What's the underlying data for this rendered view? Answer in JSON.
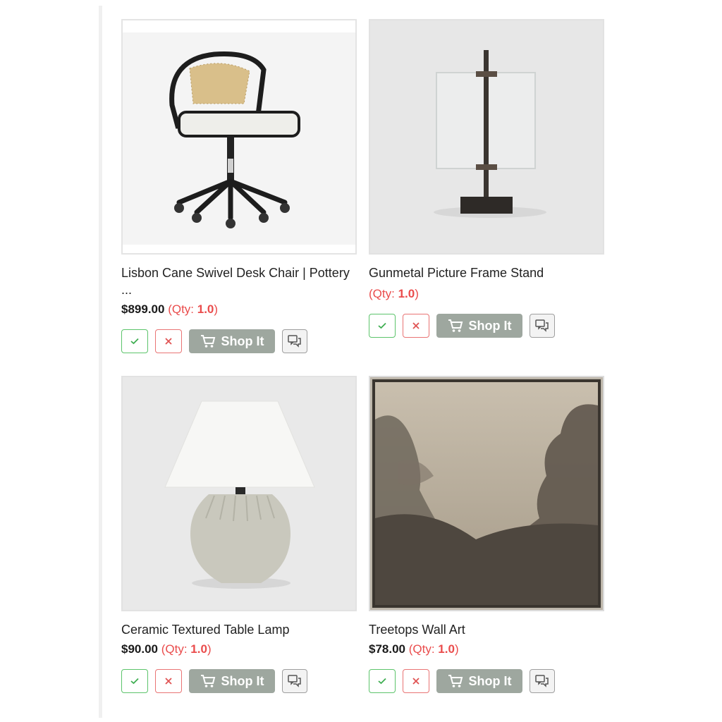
{
  "products": [
    {
      "title": "Lisbon Cane Swivel Desk Chair | Pottery ...",
      "price": "$899.00",
      "qty_prefix": "(Qty: ",
      "qty_value": "1.0",
      "qty_suffix": ")",
      "shop_label": "Shop It",
      "image_icon": "office-chair"
    },
    {
      "title": "Gunmetal Picture Frame Stand",
      "price": "",
      "qty_prefix": "(Qty: ",
      "qty_value": "1.0",
      "qty_suffix": ")",
      "shop_label": "Shop It",
      "image_icon": "frame-stand"
    },
    {
      "title": "Ceramic Textured Table Lamp",
      "price": "$90.00",
      "qty_prefix": "(Qty: ",
      "qty_value": "1.0",
      "qty_suffix": ")",
      "shop_label": "Shop It",
      "image_icon": "table-lamp"
    },
    {
      "title": "Treetops Wall Art",
      "price": "$78.00",
      "qty_prefix": "(Qty: ",
      "qty_value": "1.0",
      "qty_suffix": ")",
      "shop_label": "Shop It",
      "image_icon": "wall-art"
    }
  ],
  "icons": {
    "approve": "check-icon",
    "reject": "close-icon",
    "shop": "cart-icon",
    "comment": "comment-icon"
  },
  "colors": {
    "approve": "#5cc46b",
    "reject": "#e97474",
    "qty": "#ea4c4c",
    "shop_button": "#9ea79f"
  }
}
